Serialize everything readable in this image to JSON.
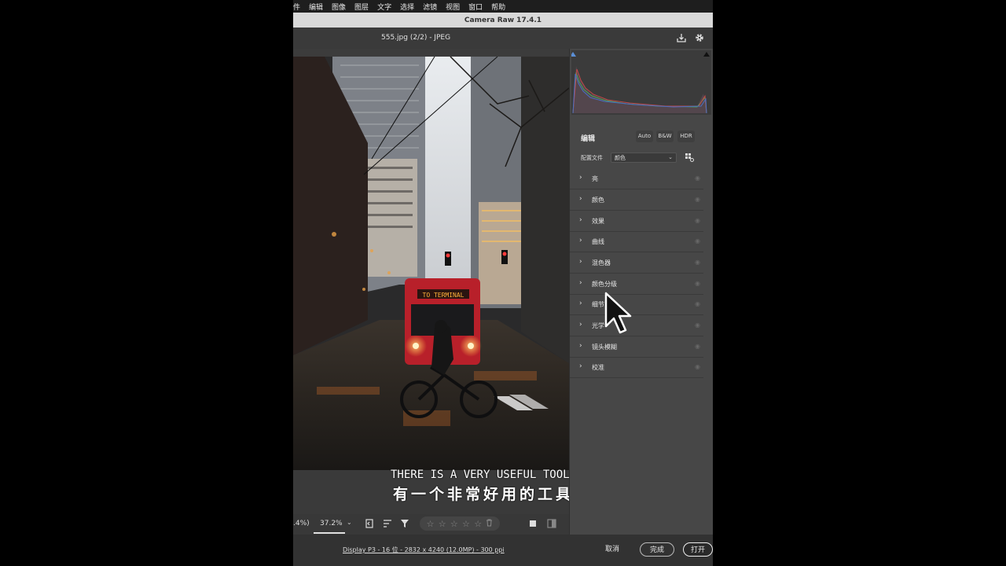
{
  "menu": [
    "件",
    "编辑",
    "图像",
    "图层",
    "文字",
    "选择",
    "滤镜",
    "视图",
    "窗口",
    "帮助"
  ],
  "window_title": "Camera Raw 17.4.1",
  "file": {
    "name": "555.jpg (2/2) -  JPEG"
  },
  "photo": {
    "sign_text": "TO TERMINAL"
  },
  "toolbar": {
    "zoom_prev": ".4%)",
    "zoom": "37.2%",
    "zoom_caret": "⌄",
    "rating_stars": [
      "☆",
      "☆",
      "☆",
      "☆",
      "☆"
    ]
  },
  "footer": {
    "info": "Display P3 - 16 位 - 2832 x 4240 (12.0MP) - 300 ppi",
    "cancel": "取消",
    "done": "完成",
    "open": "打开"
  },
  "panel": {
    "edit_title": "编辑",
    "buttons": [
      "Auto",
      "B&W",
      "HDR"
    ],
    "profile_label": "配置文件",
    "profile_value": "颜色",
    "sections": [
      "亮",
      "颜色",
      "效果",
      "曲线",
      "混色器",
      "颜色分级",
      "细节",
      "光学",
      "镜头模糊",
      "校准"
    ]
  },
  "subtitle": {
    "en": "THERE IS A VERY USEFUL TOOL,",
    "zh": "有一个非常好用的工具"
  },
  "colors": {
    "panel_bg": "#474747",
    "menu_bg": "#1e1e1e",
    "title_bg": "#d9d9d9",
    "bus_red": "#b8202a"
  }
}
